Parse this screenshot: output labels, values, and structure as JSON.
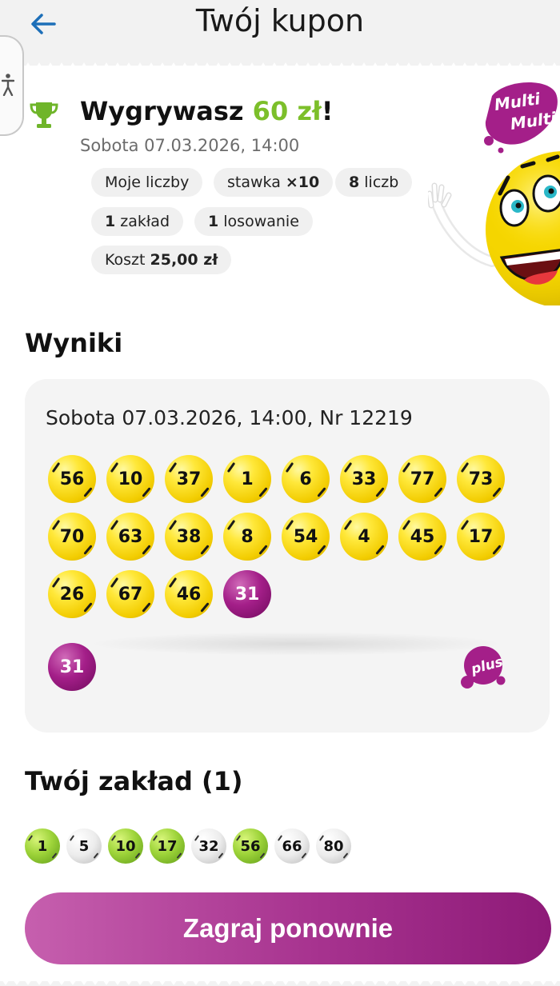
{
  "header": {
    "title": "Twój kupon"
  },
  "win": {
    "prefix": "Wygrywasz ",
    "amount": "60 zł",
    "suffix": "!",
    "date": "Sobota 07.03.2026, 14:00"
  },
  "chips": {
    "my_numbers": "Moje liczby",
    "stake_label": "stawka ",
    "stake_value": "×10",
    "count_value": "8",
    "count_label": " liczb",
    "bets_value": "1",
    "bets_label": " zakład",
    "draws_value": "1",
    "draws_label": " losowanie",
    "cost_label": "Koszt ",
    "cost_value": "25,00 zł"
  },
  "logo": {
    "line1": "Multi",
    "line2": "Multi"
  },
  "results": {
    "title": "Wyniki",
    "draw_info": "Sobota 07.03.2026, 14:00, Nr 12219",
    "numbers": [
      "56",
      "10",
      "37",
      "1",
      "6",
      "33",
      "77",
      "73",
      "70",
      "63",
      "38",
      "8",
      "54",
      "4",
      "45",
      "17",
      "26",
      "67",
      "46",
      "31"
    ],
    "plus_number": "31",
    "plus_label": "plus"
  },
  "bet": {
    "title": "Twój zakład (1)",
    "numbers": [
      {
        "value": "1",
        "hit": true
      },
      {
        "value": "5",
        "hit": false
      },
      {
        "value": "10",
        "hit": true
      },
      {
        "value": "17",
        "hit": true
      },
      {
        "value": "32",
        "hit": false
      },
      {
        "value": "56",
        "hit": true
      },
      {
        "value": "66",
        "hit": false
      },
      {
        "value": "80",
        "hit": false
      }
    ]
  },
  "actions": {
    "play_again": "Zagraj ponownie"
  },
  "colors": {
    "win_green": "#7cbf2a",
    "brand_purple": "#a41f89",
    "ball_yellow": "#f2cc00",
    "back_arrow": "#1d6fb8"
  }
}
